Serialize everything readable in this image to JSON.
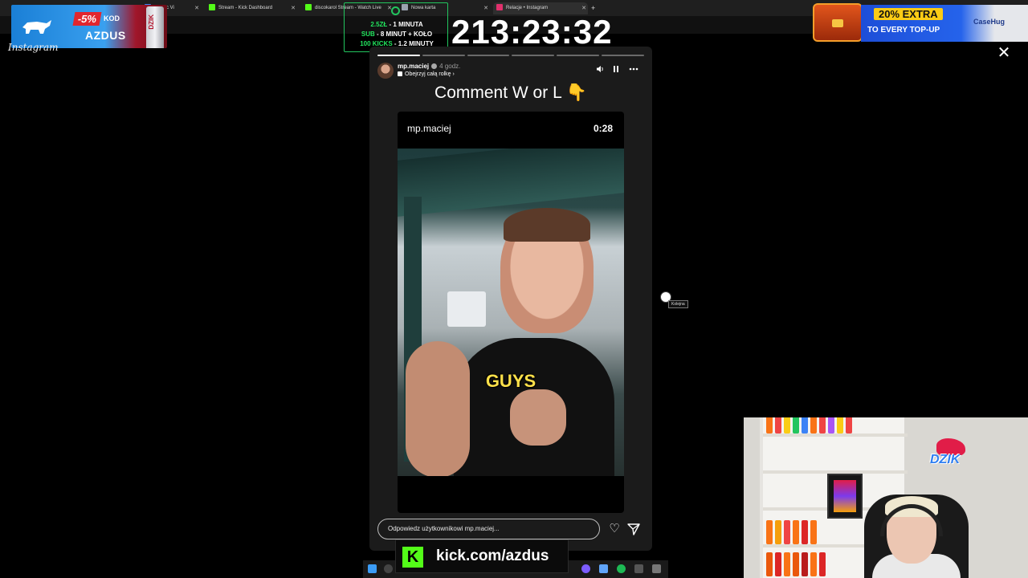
{
  "browser": {
    "tabs": [
      {
        "label": "s Byric Vi",
        "icon_color": "#3b82f6",
        "active": false
      },
      {
        "label": "Stream - Kick Dashboard",
        "icon_color": "#53fc18",
        "active": false
      },
      {
        "label": "discokarol Stream - Watch Live",
        "icon_color": "#53fc18",
        "active": false
      },
      {
        "label": "Nowa karta",
        "icon_color": "#9ca3af",
        "active": false
      },
      {
        "label": "Relacje • Instagram",
        "icon_color": "#e1306c",
        "active": true
      }
    ],
    "new_tab_symbol": "+"
  },
  "overlay": {
    "promo_left": {
      "discount": "-5%",
      "kod_label": "KOD",
      "code": "AZDUS",
      "can_brand": "DZIK"
    },
    "instagram_logo": "Instagram",
    "sub_info": [
      {
        "amount": "2.5ZŁ",
        "reward": " - 1 MINUTA"
      },
      {
        "amount": "SUB",
        "reward": " - 8 MINUT + KOŁO"
      },
      {
        "amount": "100 KICKS",
        "reward": " - 1.2 MINUTY"
      }
    ],
    "timer": "213:23:32",
    "promo_right": {
      "badge": "20% EXTRA",
      "subtitle": "TO EVERY TOP-UP",
      "brand": "CaseHug"
    }
  },
  "story": {
    "progress_segments_total": 6,
    "progress_segments_done": 1,
    "username": "mp.maciej",
    "time_ago": "4 godz.",
    "reel_link": "Obejrzyj całą rolkę",
    "caption": "Comment W or L 👇",
    "reel": {
      "username": "mp.maciej",
      "duration": "0:28",
      "subtitle_word": "GUYS"
    },
    "reply_placeholder": "Odpowiedz użytkownikowi mp.maciej...",
    "icons": {
      "mute": "volume-icon",
      "pause": "pause-icon",
      "more": "more-icon",
      "like": "heart-icon",
      "send": "send-icon"
    },
    "next_tooltip": "Kolejna"
  },
  "kick_banner": {
    "logo": "K",
    "url": "kick.com/azdus"
  },
  "webcam": {
    "brand": "DZIK"
  }
}
